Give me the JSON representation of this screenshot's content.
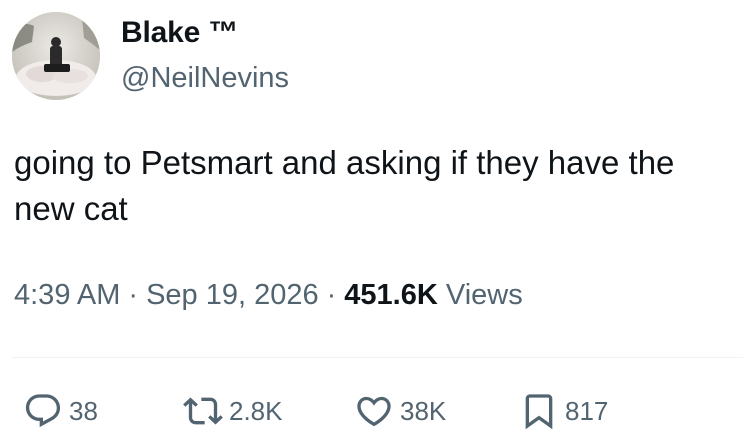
{
  "author": {
    "display_name": "Blake ™",
    "handle": "@NeilNevins"
  },
  "tweet": {
    "text": "going to Petsmart and asking if they have the new cat"
  },
  "meta": {
    "time": "4:39 AM",
    "date": "Sep 19, 2026",
    "separator": "·",
    "views_count": "451.6K",
    "views_label": "Views"
  },
  "actions": {
    "replies": "38",
    "reposts": "2.8K",
    "likes": "38K",
    "bookmarks": "817"
  },
  "icons": {
    "reply": "reply-icon",
    "repost": "repost-icon",
    "like": "heart-icon",
    "bookmark": "bookmark-icon"
  },
  "colors": {
    "text_primary": "#0f1419",
    "text_secondary": "#536471",
    "divider": "#eff3f4"
  }
}
